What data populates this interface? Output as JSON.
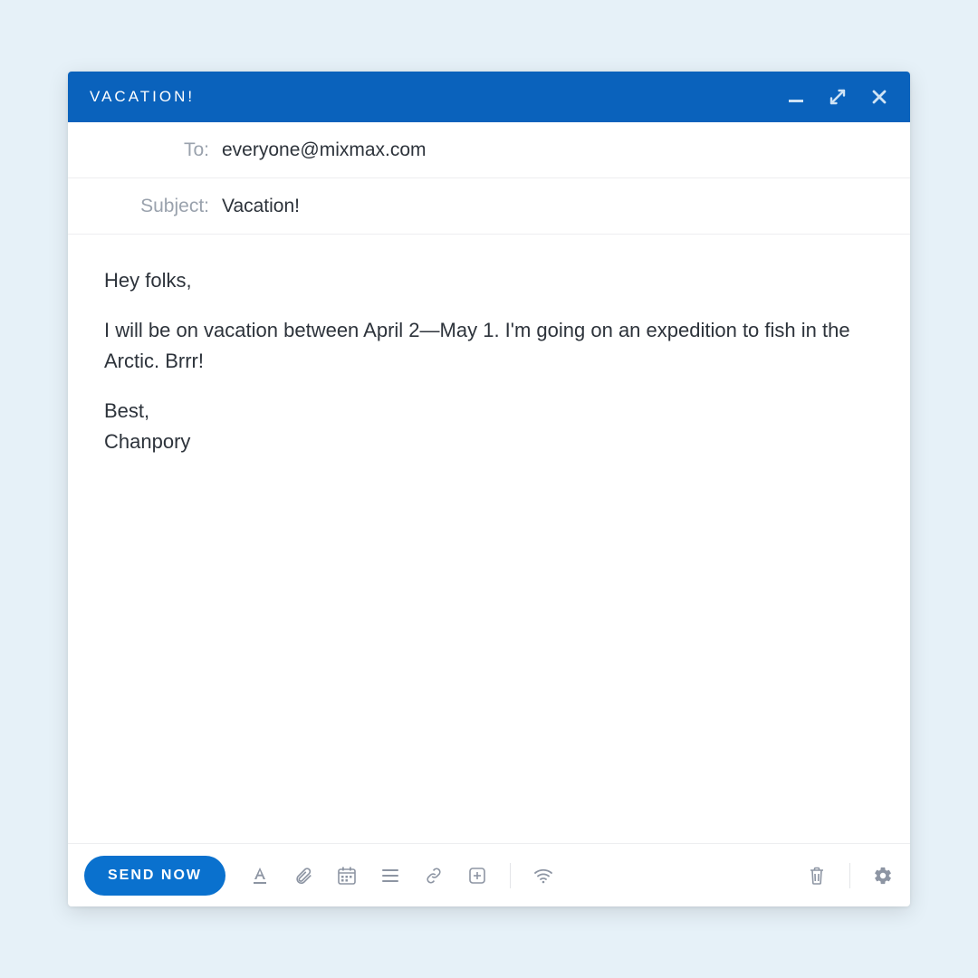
{
  "window": {
    "title": "VACATION!"
  },
  "fields": {
    "to_label": "To:",
    "to_value": "everyone@mixmax.com",
    "subject_label": "Subject:",
    "subject_value": "Vacation!"
  },
  "body": {
    "p1": "Hey folks,",
    "p2": "I will be on vacation between April 2—May 1. I'm going on an expedition to fish in the Arctic. Brrr!",
    "p3": "Best,\nChanpory"
  },
  "toolbar": {
    "send_label": "SEND NOW"
  },
  "colors": {
    "primary": "#0a62bc",
    "accent": "#0a71ce",
    "icon": "#8d95a3",
    "border": "#edeef0",
    "text": "#2d333b",
    "muted": "#9aa2ad",
    "page_bg": "#e6f1f8"
  }
}
